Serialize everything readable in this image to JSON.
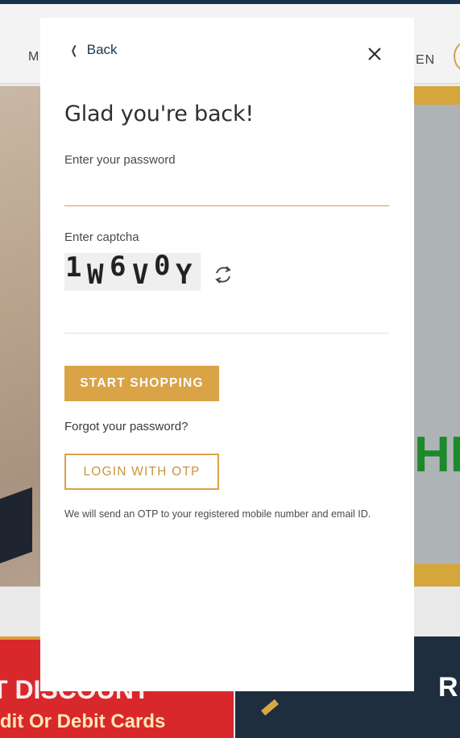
{
  "background": {
    "nav_left": "M",
    "nav_right": "EN",
    "hero_text": "HIN",
    "banner_line1": "T DISCOUNT",
    "banner_line2": "dit Or Debit Cards",
    "banner_right_letter": "R"
  },
  "modal": {
    "back_label": "Back",
    "title": "Glad you're back!",
    "password_label": "Enter your password",
    "password_value": "",
    "captcha_label": "Enter captcha",
    "captcha_code": "1W6V0Y",
    "captcha_value": "",
    "primary_button": "START SHOPPING",
    "forgot_link": "Forgot your password?",
    "otp_button": "LOGIN WITH OTP",
    "otp_note": "We will send an OTP to your registered mobile number and email ID."
  },
  "colors": {
    "accent": "#d9a346",
    "heading": "#2f2f2f",
    "link_dark": "#1d3550"
  },
  "icons": [
    "chevron-left-icon",
    "close-icon",
    "refresh-icon"
  ]
}
